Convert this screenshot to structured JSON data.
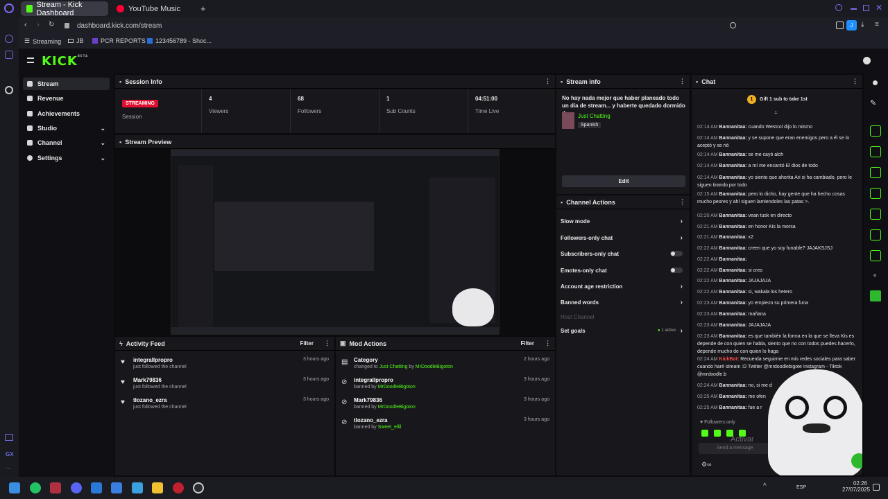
{
  "browser": {
    "tabs": [
      {
        "label": "Stream - Kick Dashboard"
      },
      {
        "label": "YouTube Music"
      }
    ],
    "url": "dashboard.kick.com/stream",
    "bookmarks": [
      "Streaming",
      "JB",
      "PCR REPORTS",
      "123456789 - Shoc..."
    ]
  },
  "kick": {
    "logo": "KICK",
    "logo_badge": "BETA"
  },
  "nav": {
    "items": [
      {
        "label": "Stream",
        "icon": "broadcast-icon"
      },
      {
        "label": "Revenue",
        "icon": "revenue-icon"
      },
      {
        "label": "Achievements",
        "icon": "trophy-icon"
      },
      {
        "label": "Studio",
        "icon": "studio-icon"
      },
      {
        "label": "Channel",
        "icon": "channel-icon"
      },
      {
        "label": "Settings",
        "icon": "gear-icon"
      }
    ]
  },
  "session": {
    "title": "Session Info",
    "status": "STREAMING",
    "status_label": "Session",
    "stats": [
      {
        "value": "4",
        "label": "Viewers"
      },
      {
        "value": "68",
        "label": "Followers"
      },
      {
        "value": "1",
        "label": "Sub Counts"
      },
      {
        "value": "04:51:00",
        "label": "Time Live"
      }
    ]
  },
  "preview": {
    "title": "Stream Preview"
  },
  "stream_info": {
    "title": "Stream info",
    "stream_title": "No hay nada mejor que haber planeado todo un día de stream... y haberte quedado dormido :)",
    "category": "Just Chatting",
    "language": "Spanish",
    "edit_label": "Edit"
  },
  "channel_actions": {
    "title": "Channel Actions",
    "items": [
      {
        "label": "Slow mode",
        "control": "arrow"
      },
      {
        "label": "Followers-only chat",
        "control": "arrow"
      },
      {
        "label": "Subscribers-only chat",
        "control": "toggle"
      },
      {
        "label": "Emotes-only chat",
        "control": "toggle"
      },
      {
        "label": "Account age restriction",
        "control": "arrow"
      },
      {
        "label": "Banned words",
        "control": "arrow"
      },
      {
        "label": "Host Channel",
        "control": "none"
      },
      {
        "label": "Set goals",
        "control": "arrow"
      }
    ],
    "goals_badge": "1 active"
  },
  "activity": {
    "title": "Activity Feed",
    "filter": "Filter",
    "items": [
      {
        "name": "integrallpropro",
        "sub": "just followed the channel",
        "time": "3 hours ago"
      },
      {
        "name": "Mark79836",
        "sub": "just followed the channel",
        "time": "3 hours ago"
      },
      {
        "name": "tlozano_ezra",
        "sub": "just followed the channel",
        "time": "3 hours ago"
      }
    ]
  },
  "mod": {
    "title": "Mod Actions",
    "filter": "Filter",
    "items": [
      {
        "name": "Category",
        "pre": "changed to",
        "hl": "Just Chatting",
        "mid": "by",
        "by": "MrDoodleBigoton",
        "time": "2 hours ago"
      },
      {
        "name": "integrallpropro",
        "pre": "banned by",
        "hl": "",
        "mid": "",
        "by": "MrDoodleBigoton",
        "time": "3 hours ago"
      },
      {
        "name": "Mark79836",
        "pre": "banned by",
        "hl": "",
        "mid": "",
        "by": "MrDoodleBigoton",
        "time": "3 hours ago"
      },
      {
        "name": "tlozano_ezra",
        "pre": "banned by",
        "hl": "",
        "mid": "",
        "by": "Sweet_ellil",
        "time": "3 hours ago"
      }
    ]
  },
  "chat": {
    "title": "Chat",
    "gift": "Gift 1 sub to take 1st",
    "gift_count": "1",
    "messages": [
      {
        "ts": "02:14 AM",
        "user": "Bannanitaa:",
        "text": "cuando Westcol dijo lo mismo"
      },
      {
        "ts": "02:14 AM",
        "user": "Bannanitaa:",
        "text": "y se supone que eran enemigos pero a él se lo aceptó y se rió"
      },
      {
        "ts": "02:14 AM",
        "user": "Bannanitaa:",
        "text": "se me cayó alch"
      },
      {
        "ts": "02:14 AM",
        "user": "Bannanitaa:",
        "text": "a mí me encantó El dios de todo"
      },
      {
        "ts": "02:14 AM",
        "user": "Bannanitaa:",
        "text": "yo siento que ahorita Ari si ha cambiado, pero le siguen tirando por todo"
      },
      {
        "ts": "02:15 AM",
        "user": "Bannanitaa:",
        "text": "pero lo dicho, hay gente que ha hecho cosas mucho peores y ahí siguen lamiendoles las patas >."
      },
      {
        "ts": "02:20 AM",
        "user": "Bannanitaa:",
        "text": "vean tusk en directo"
      },
      {
        "ts": "02:21 AM",
        "user": "Bannanitaa:",
        "text": "en honor Kis la morsa"
      },
      {
        "ts": "02:21 AM",
        "user": "Bannanitaa:",
        "text": "x2"
      },
      {
        "ts": "02:22 AM",
        "user": "Bannanitaa:",
        "text": "creen que yo soy funable? JAJAKSJSJ"
      },
      {
        "ts": "02:22 AM",
        "user": "Bannanitaa:",
        "text": ""
      },
      {
        "ts": "02:22 AM",
        "user": "Bannanitaa:",
        "text": "si creo"
      },
      {
        "ts": "02:22 AM",
        "user": "Bannanitaa:",
        "text": "JAJAJAJA"
      },
      {
        "ts": "02:22 AM",
        "user": "Bannanitaa:",
        "text": "si, wakala los hetero"
      },
      {
        "ts": "02:23 AM",
        "user": "Bannanitaa:",
        "text": "yo empiezo su primera funa"
      },
      {
        "ts": "02:23 AM",
        "user": "Bannanitaa:",
        "text": "mañana"
      },
      {
        "ts": "02:23 AM",
        "user": "Bannanitaa:",
        "text": "JAJAJAJA"
      },
      {
        "ts": "02:23 AM",
        "user": "Bannanitaa:",
        "text": "es que también la forma en la que se lleva Kis es depende de con quien se habla, siento que no con todos puedes hacerlo, depende mucho de con quien lo haga"
      },
      {
        "ts": "02:24 AM",
        "user": "KickBot:",
        "text": "Recuerda seguirme en mis redes sociales para saber cuando haré stream :D Twitter @mrdoodlebigote Instagram - Tiktok @mrdoodle.b"
      },
      {
        "ts": "02:24 AM",
        "user": "Bannanitaa:",
        "text": "no, si me d"
      },
      {
        "ts": "02:25 AM",
        "user": "Bannanitaa:",
        "text": "me ofen"
      },
      {
        "ts": "02:25 AM",
        "user": "Bannanitaa:",
        "text": "fue a r"
      }
    ],
    "followers_only": "Followers only",
    "send_placeholder": "Send a message",
    "activate_text": "Activar"
  },
  "taskbar": {
    "time": "02:26",
    "date": "27/07/2025",
    "lang": "ESP"
  }
}
